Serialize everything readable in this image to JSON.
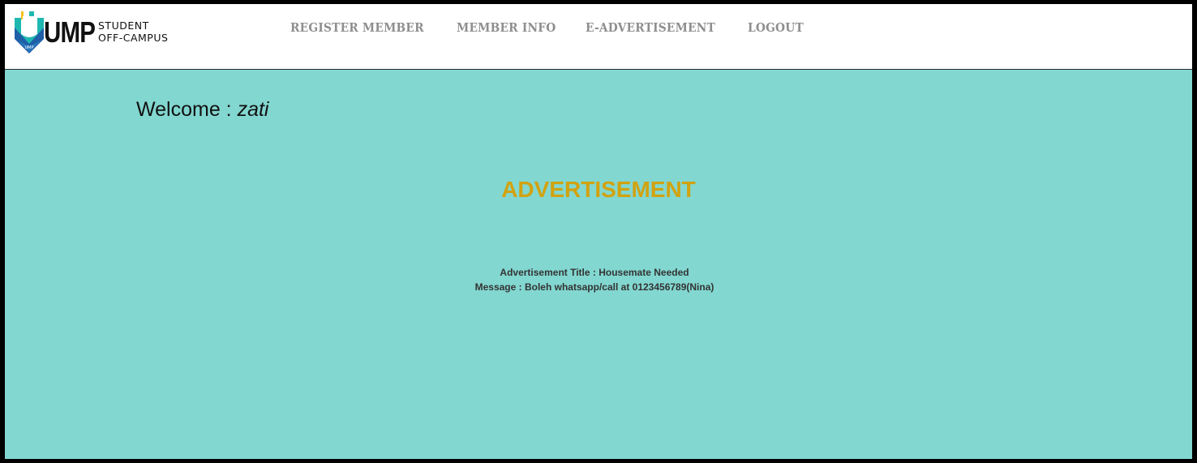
{
  "logo": {
    "brand": "UMP",
    "subtitle_line1": "STUDENT",
    "subtitle_line2": "OFF-CAMPUS",
    "colors": {
      "shield_blue": "#1f5fa8",
      "shield_teal": "#1fb8b0",
      "shield_yellow": "#f2c21a"
    }
  },
  "nav": {
    "items": [
      {
        "id": "register",
        "label": "REGISTER MEMBER"
      },
      {
        "id": "member-info",
        "label": "MEMBER INFO"
      },
      {
        "id": "e-advertisement",
        "label": "E-ADVERTISEMENT"
      },
      {
        "id": "logout",
        "label": "LOGOUT"
      }
    ],
    "color": "#8e8e8e"
  },
  "welcome": {
    "prefix": "Welcome : ",
    "username": "zati"
  },
  "advertisement": {
    "heading": "ADVERTISEMENT",
    "title_line": "Advertisement Title : Housemate Needed",
    "message_line": "Message : Boleh whatsapp/call at 0123456789(Nina)"
  },
  "colors": {
    "main_background": "#82d7d0",
    "heading": "#d2a20f",
    "frame": "#000000"
  }
}
